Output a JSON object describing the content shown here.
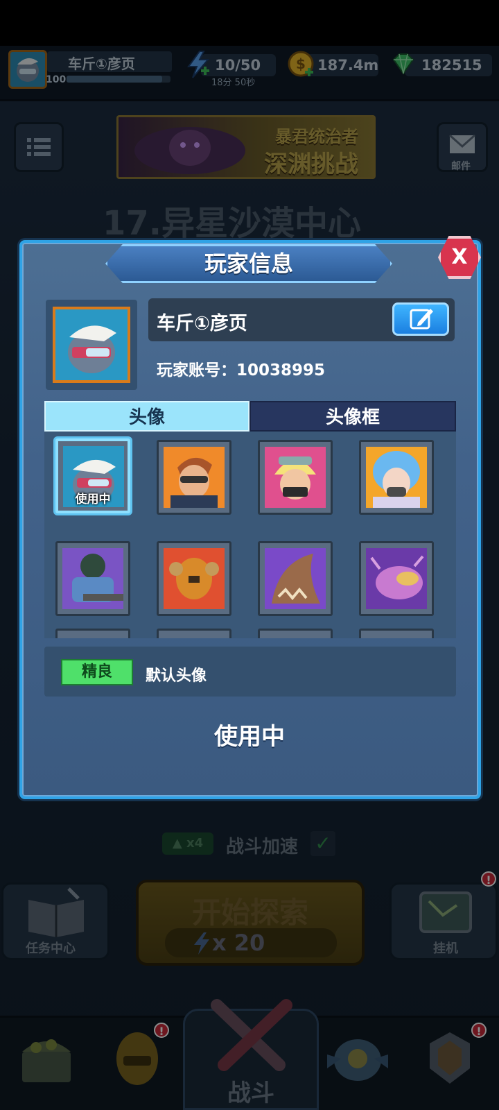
{
  "topbar": {
    "player_name": "车斤①彦页",
    "level": "100",
    "energy": "10/50",
    "energy_timer": "18分 50秒",
    "gold": "187.4m",
    "gems": "182515"
  },
  "lobby": {
    "mail_label": "邮件",
    "banner_line1": "暴君统治者",
    "banner_line2": "深渊挑战",
    "stage_title": "17.异星沙漠中心",
    "speed_badge": "x4",
    "speed_label": "战斗加速",
    "task_label": "任务中心",
    "start_label": "开始探索",
    "start_cost": "x 20",
    "idle_label": "挂机",
    "nav_battle": "战斗"
  },
  "dialog": {
    "title": "玩家信息",
    "close_label": "X",
    "player_name": "车斤①彦页",
    "account_label": "玩家账号：10038995",
    "tab_avatar": "头像",
    "tab_frame": "头像框",
    "selected_overlay": "使用中",
    "rarity_badge": "精良",
    "avatar_desc": "默认头像",
    "status_text": "使用中"
  },
  "icons": [
    "knight-helmet-icon",
    "energy-bolt-icon",
    "gold-coin-icon",
    "gem-icon",
    "menu-icon",
    "mail-icon",
    "edit-icon",
    "check-icon",
    "book-icon",
    "map-icon",
    "treasure-chest-icon",
    "crossed-swords-icon"
  ]
}
